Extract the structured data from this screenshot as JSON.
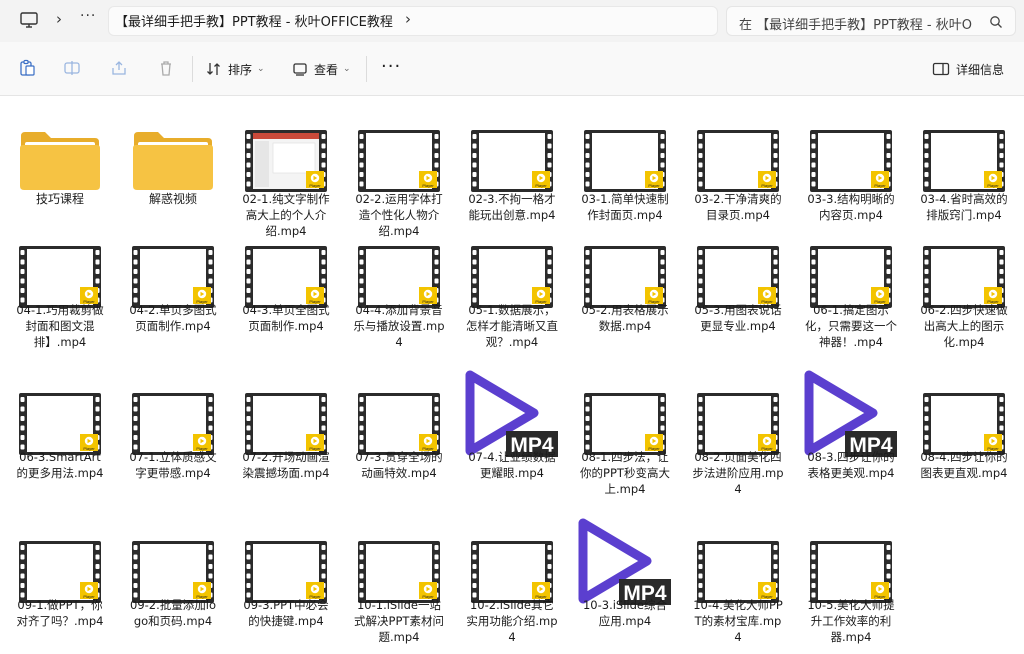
{
  "address": {
    "breadcrumb": "【最详细手把手教】PPT教程 - 秋叶OFFICE教程",
    "overflow_dots": "···",
    "search_placeholder": "在 【最详细手把手教】PPT教程 - 秋叶O"
  },
  "toolbar": {
    "sort_label": "排序",
    "view_label": "查看",
    "more_label": "···",
    "details_label": "详细信息"
  },
  "badge_text": "MP4",
  "player_text": "Player",
  "colors": {
    "folder": "#f6c343",
    "accent": "#5b3fcf",
    "badge": "#f3c400",
    "film": "#2b2b2b"
  },
  "files": [
    {
      "label": "技巧课程",
      "kind": "folder"
    },
    {
      "label": "解惑视频",
      "kind": "folder"
    },
    {
      "label": "02-1.纯文字制作高大上的个人介绍.mp4",
      "kind": "video-thumb"
    },
    {
      "label": "02-2.运用字体打造个性化人物介绍.mp4",
      "kind": "video"
    },
    {
      "label": "02-3.不拘一格才能玩出创意.mp4",
      "kind": "video"
    },
    {
      "label": "03-1.简单快速制作封面页.mp4",
      "kind": "video"
    },
    {
      "label": "03-2.干净清爽的目录页.mp4",
      "kind": "video"
    },
    {
      "label": "03-3.结构明晰的内容页.mp4",
      "kind": "video"
    },
    {
      "label": "03-4.省时高效的排版窍门.mp4",
      "kind": "video"
    },
    {
      "label": "04-1.巧用裁剪做封面和图文混排】.mp4",
      "kind": "video"
    },
    {
      "label": "04-2.单页多图式页面制作.mp4",
      "kind": "video"
    },
    {
      "label": "04-3.单页全图式页面制作.mp4",
      "kind": "video"
    },
    {
      "label": "04-4.添加背景音乐与播放设置.mp4",
      "kind": "video"
    },
    {
      "label": "05-1.数据展示，怎样才能清晰又直观？.mp4",
      "kind": "video"
    },
    {
      "label": "05-2.用表格展示数据.mp4",
      "kind": "video"
    },
    {
      "label": "05-3.用图表说话更显专业.mp4",
      "kind": "video"
    },
    {
      "label": "06-1.搞定图示化，只需要这一个神器！.mp4",
      "kind": "video"
    },
    {
      "label": "06-2.四步快速做出高大上的图示化.mp4",
      "kind": "video"
    },
    {
      "label": "06-3.SmartArt的更多用法.mp4",
      "kind": "video"
    },
    {
      "label": "07-1.立体质感文字更带感.mp4",
      "kind": "video"
    },
    {
      "label": "07-2.开场动画渲染震撼场面.mp4",
      "kind": "video"
    },
    {
      "label": "07-3.贯穿全场的动画特效.mp4",
      "kind": "video"
    },
    {
      "label": "07-4.让业绩数据更耀眼.mp4",
      "kind": "mp4"
    },
    {
      "label": "08-1.四步法，让你的PPT秒变高大上.mp4",
      "kind": "video"
    },
    {
      "label": "08-2.页面美化四步法进阶应用.mp4",
      "kind": "video"
    },
    {
      "label": "08-3.四步让你的表格更美观.mp4",
      "kind": "mp4"
    },
    {
      "label": "08-4.四步让你的图表更直观.mp4",
      "kind": "video"
    },
    {
      "label": "09-1.做PPT，你对齐了吗？.mp4",
      "kind": "video"
    },
    {
      "label": "09-2.批量添加logo和页码.mp4",
      "kind": "video"
    },
    {
      "label": "09-3.PPT中必会的快捷键.mp4",
      "kind": "video"
    },
    {
      "label": "10-1.iSlide一站式解决PPT素材问题.mp4",
      "kind": "video"
    },
    {
      "label": "10-2.iSlide其它实用功能介绍.mp4",
      "kind": "video"
    },
    {
      "label": "10-3.iSlide综合应用.mp4",
      "kind": "mp4"
    },
    {
      "label": "10-4.美化大师PPT的素材宝库.mp4",
      "kind": "video"
    },
    {
      "label": "10-5.美化大师提升工作效率的利器.mp4",
      "kind": "video"
    }
  ]
}
